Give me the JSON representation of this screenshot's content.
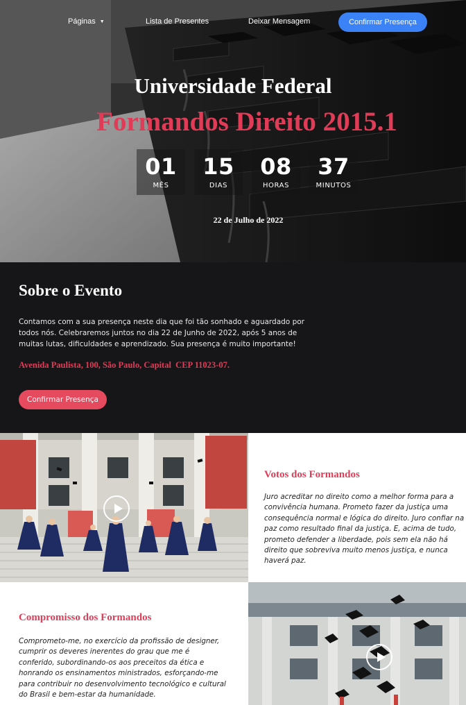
{
  "nav": {
    "paginas": "Páginas",
    "presentes": "Lista de Presentes",
    "mensagem": "Deixar Mensagem",
    "cta": "Confirmar Presença"
  },
  "hero": {
    "subtitle": "Universidade Federal",
    "title": "Formandos Direito 2015.1",
    "date": "22 de Julho de 2022",
    "countdown": [
      {
        "value": "01",
        "label": "MÊS"
      },
      {
        "value": "15",
        "label": "DIAS"
      },
      {
        "value": "08",
        "label": "HORAS"
      },
      {
        "value": "37",
        "label": "MINUTOS"
      }
    ]
  },
  "about": {
    "title": "Sobre o Evento",
    "text": "Contamos com a sua presença neste dia que foi tão sonhado e aguardado por todos nós. Celebraremos juntos no dia 22 de Junho de 2022, após 5 anos de muitas lutas, dificuldades e aprendizado. Sua presença é muito importante!",
    "address": "Avenida Paulista, 100, São Paulo, Capital  CEP 11023-07.",
    "button": "Confirmar Presença"
  },
  "votos": {
    "title": "Votos dos Formandos",
    "text": "Juro acreditar no direito como a melhor forma para a convivência humana. Prometo fazer da justiça uma consequência normal e lógica do direito. Juro confiar na paz como resultado final da justiça. E, acima de tudo, prometo defender a liberdade, pois sem ela não há direito que sobreviva muito menos justiça, e nunca haverá paz."
  },
  "compromisso": {
    "title": "Compromisso dos Formandos",
    "text": "Comprometo-me, no exercício da profissão de designer, cumprir os deveres inerentes do grau que me é conferido, subordinando-os aos preceitos da ética e honrando os ensinamentos ministrados, esforçando-me para contribuir no desenvolvimento tecnológico e cultural do Brasil e bem-estar da humanidade."
  },
  "icons": {
    "play": "play-icon",
    "caret": "chevron-down-icon"
  },
  "colors": {
    "accent": "#e03c57",
    "nav_cta": "#3b82f6",
    "about_bg": "#161618"
  }
}
